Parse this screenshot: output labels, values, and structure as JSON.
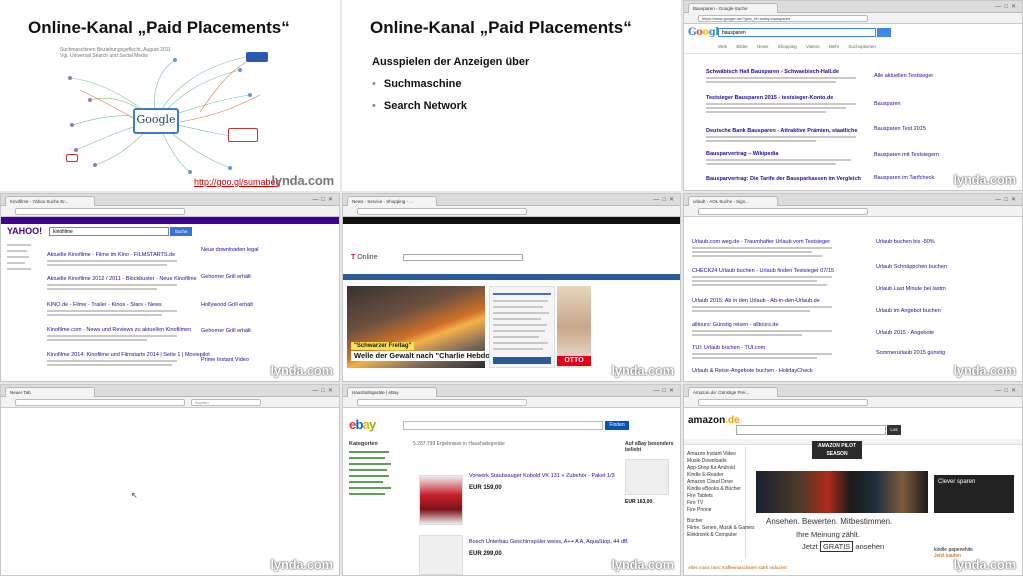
{
  "watermark": "lynda.com",
  "slide1": {
    "title": "Online-Kanal „Paid Placements“",
    "caption_line1": "Suchmaschinen Beziehungsgeflecht, August 2011",
    "caption_line2": "Vgl. Universal Search und Social Media",
    "center_logo": "Google",
    "link": "http://goo.gl/sumabeg"
  },
  "slide2": {
    "title": "Online-Kanal „Paid Placements“",
    "subtitle": "Ausspielen der Anzeigen über",
    "bullets": [
      "Suchmaschine",
      "Search Network"
    ]
  },
  "google": {
    "tab": "Bausparen - Google-Suche",
    "url": "https://www.google.de/?gws_rd=ssl#q=bausparen",
    "logo": "Google",
    "query": "bausparen",
    "tabs": "Web Bilder News Shopping Videos Mehr Suchoptionen",
    "results": [
      "Schwäbisch Hall Bausparen - Schwaebisch-Hall.de",
      "Testsieger Bausparen 2015 - testsieger-Konto.de",
      "Deutsche Bank Bausparen - Attraktive Prämien, staatliche",
      "Bausparvertrag – Wikipedia",
      "Bausparvertrag: Die Tarife der Bausparkassen im Vergleich"
    ],
    "ads": [
      "Alle aktuellen Testsieger",
      "Bausparen",
      "Bausparen Test 2015",
      "Bausparen mit Testsiegern",
      "Bausparen im Tarifcheck"
    ]
  },
  "yahoo": {
    "tab": "Kinofilme - Yahoo Suche Er...",
    "logo": "YAHOO!",
    "query": "kinofilme",
    "button": "Suche",
    "results": [
      "Aktuelle Kinofilme - Filme im Kino - FILMSTARTS.de",
      "Aktuelle Kinofilme 2012 / 2011 - Blockbuster - Neue Kinofilme",
      "KINO.de - Filme - Trailer - Kinos - Stars - News",
      "Kinofilme.com - News und Reviews zu aktuellen Kinofilmen",
      "Kinofilme 2014: Kinofilme und Filmstarts 2014 | Seite 1 | Moviepilot"
    ],
    "ads": [
      "Neue downloaden legal",
      "Gehorner Grill erhält",
      "Hollywood Grill erhält",
      "Gehorner Grill erhält",
      "Prime Instant Video"
    ]
  },
  "tonline": {
    "tab": "News - Service - Shopping - ...",
    "logo_prefix": "T",
    "logo": "Online",
    "caption_label": "\"Schwarzer Freitag\"",
    "caption_headline": "Welle der Gewalt nach \"Charlie Hebdo\"-Karikatur",
    "ad_brand": "OTTO"
  },
  "mobile": {
    "tab": "urlaub - AOL Suche - Sign...",
    "results": [
      "Urlaub.com weg.de - Traumhafter Urlaub vom Testsieger",
      "CHECK24 Urlaub buchen - Urlaub finden Testsieger 07/15",
      "Urlaub 2015: Ab in den Urlaub - Ab-in-den-Urlaub.de",
      "alltours: Günstig reisen - alltours.de",
      "TUI: Urlaub buchen - TUI.com",
      "Urlaub & Reise-Angebote buchen - HolidayCheck"
    ],
    "ads": [
      "Urlaub buchen bis -50%",
      "Urlaub Schnäppchen buchen",
      "Urlaub Last Minute bei lastm",
      "Urlaub im Angebot buchen",
      "Urlaub 2015 - Angebote",
      "Sommerurlaub 2015 günstig"
    ]
  },
  "blank": {
    "tab": "Neuer Tab",
    "search_placeholder": "Suchen"
  },
  "ebay": {
    "tab": "Haushaltsgeräte | eBay",
    "logo": "ebay",
    "button": "Finden",
    "count": "5.287.799 Ergebnisse in Haushaltsgeräte",
    "categories": "Kategorien",
    "listing1": "Vorwerk Staubsauger Kobold VK 131 + Zubehör - Paket 1/3",
    "price1": "EUR 159,00",
    "listing2": "Bosch Unterbau Geschirrspüler weiss, A++ A A, AquaStop, 44 dB",
    "price2": "EUR 299,00",
    "side": "Auf eBay besonders beliebt",
    "side_price": "EUR 163,00"
  },
  "amazon": {
    "tab": "Amazon.de: Günstige Prei...",
    "logo": "amazon",
    "logo_suffix": ".de",
    "search_button": "Los",
    "pilot": "AMAZON PILOT SEASON",
    "tagline1": "Ansehen. Bewerten. Mitbestimmen.",
    "tagline2_pre": "Ihre Meinung zählt.",
    "tagline3_pre": "Jetzt",
    "tagline3_box": "GRATIS",
    "tagline3_post": "ansehen",
    "right_ad": "Clever sparen",
    "kindle": "kindle paperwhite",
    "kindle_sub": "Jetzt kaufen",
    "footer": "Alles muss raus: Kaffeemaschinen stark reduziert",
    "menu": [
      "Amazon Instant Video",
      "Musik-Downloads",
      "App-Shop für Android",
      "Kindle E-Reader",
      "Amazon Cloud Drive",
      "Kindle eBooks & Bücher",
      "Fire Tablets",
      "Fire TV",
      "Fire Phone",
      "Bücher",
      "Filme, Serien, Musik & Games",
      "Elektronik & Computer"
    ]
  },
  "colors": {
    "google_blue": "#4285f4",
    "yahoo_purple": "#400090",
    "telekom_magenta": "#e20074",
    "ebay_blue": "#0654ba",
    "amazon_orange": "#ff9900"
  }
}
